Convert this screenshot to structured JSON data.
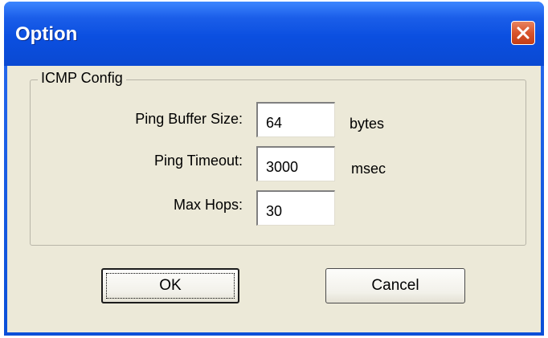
{
  "window": {
    "title": "Option",
    "close_icon": "close-icon"
  },
  "group": {
    "legend": "ICMP Config"
  },
  "fields": {
    "buffer": {
      "label": "Ping Buffer Size:",
      "value": "64",
      "unit": "bytes"
    },
    "timeout": {
      "label": "Ping Timeout:",
      "value": "3000",
      "unit": "msec"
    },
    "hops": {
      "label": "Max Hops:",
      "value": "30"
    }
  },
  "buttons": {
    "ok": "OK",
    "cancel": "Cancel"
  },
  "colors": {
    "titlebar": "#0a4fd8",
    "client_bg": "#ece9d8",
    "close_button": "#d8542c"
  }
}
